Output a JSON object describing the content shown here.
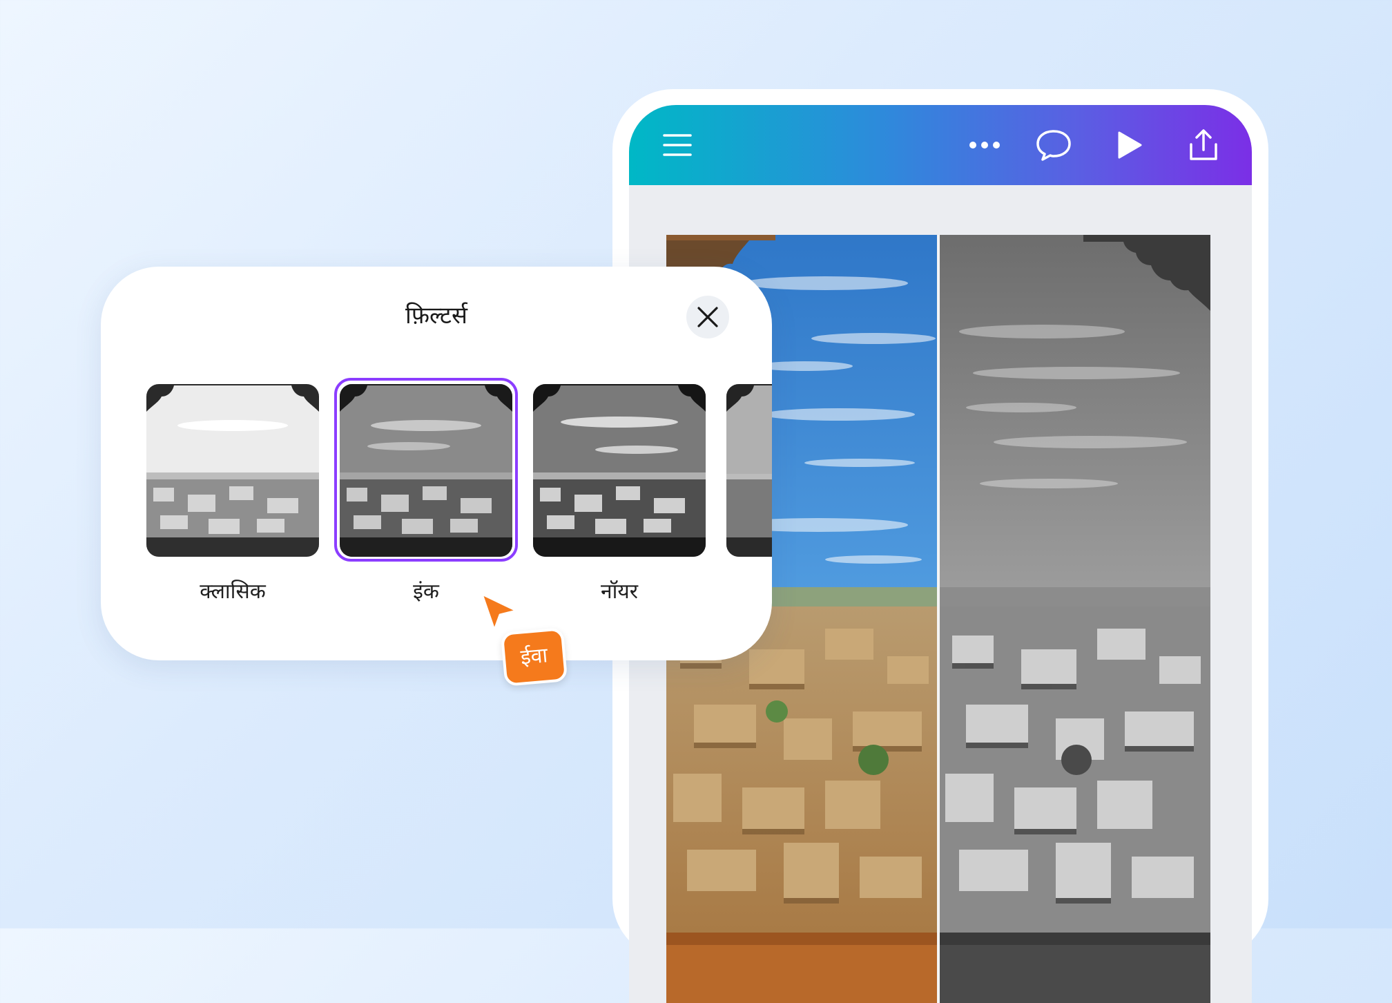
{
  "panel": {
    "title": "फ़िल्टर्स",
    "close_icon": "close-icon",
    "filters": [
      {
        "label": "क्लासिक",
        "selected": false
      },
      {
        "label": "इंक",
        "selected": true
      },
      {
        "label": "नॉयर",
        "selected": false
      },
      {
        "label": "",
        "selected": false
      }
    ],
    "selected_color": "#8b3dff"
  },
  "toolbar": {
    "icons": [
      "menu-icon",
      "more-icon",
      "comment-icon",
      "play-icon",
      "share-icon"
    ],
    "gradient": [
      "#00b8c6",
      "#7b2fe6"
    ]
  },
  "collaborator": {
    "name": "ईवा",
    "color": "#f57a1c"
  },
  "editor": {
    "comparison": [
      "original",
      "ink-filter"
    ]
  }
}
